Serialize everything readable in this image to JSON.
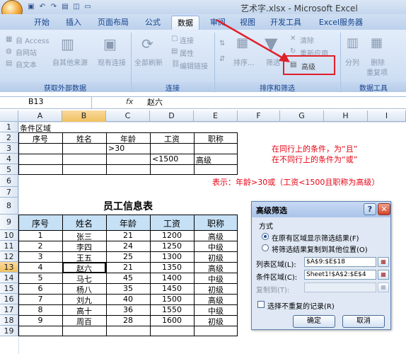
{
  "window": {
    "title": "艺术字.xlsx - Microsoft Excel"
  },
  "tabs": [
    {
      "label": "开始"
    },
    {
      "label": "插入"
    },
    {
      "label": "页面布局"
    },
    {
      "label": "公式"
    },
    {
      "label": "数据"
    },
    {
      "label": "审阅"
    },
    {
      "label": "视图"
    },
    {
      "label": "开发工具"
    },
    {
      "label": "Excel服务器"
    }
  ],
  "ribbon": {
    "ext": {
      "access": "自 Access",
      "web": "自网站",
      "text": "自文本",
      "other": "自其他来源",
      "existing": "现有连接",
      "group": "获取外部数据"
    },
    "conn": {
      "refresh": "全部刷新",
      "connections": "连接",
      "properties": "属性",
      "edit_links": "编辑链接",
      "group": "连接"
    },
    "sort": {
      "sort": "排序...",
      "filter": "筛选",
      "clear": "清除",
      "reapply": "重新应用",
      "advanced": "高级",
      "group": "排序和筛选"
    },
    "tools": {
      "split": "分列",
      "remove_dup": "删除",
      "remove_dup2": "重复项",
      "group": "数据工具"
    }
  },
  "formula_bar": {
    "name_box": "B13",
    "fx": "fx",
    "value": "赵六"
  },
  "columns": [
    "A",
    "B",
    "C",
    "D",
    "E",
    "F",
    "G",
    "H",
    "I"
  ],
  "rows": [
    "1",
    "2",
    "3",
    "4",
    "5",
    "6",
    "7",
    "8",
    "9",
    "10",
    "11",
    "12",
    "13",
    "14",
    "15",
    "16",
    "17",
    "18",
    "19"
  ],
  "sheet": {
    "a1": "条件区域",
    "crit_headers": [
      "序号",
      "姓名",
      "年龄",
      "工资",
      "职称"
    ],
    "crit_age": ">30",
    "crit_salary": "<1500",
    "crit_title": "高级",
    "note1": "在同行上的条件，为“且”",
    "note2": "在不同行上的条件为“或”",
    "note3": "表示：年龄>30或（工资<1500且职称为高级）",
    "table_title": "员工信息表",
    "headers": [
      "序号",
      "姓名",
      "年龄",
      "工资",
      "职称"
    ],
    "data": [
      [
        "1",
        "张三",
        "21",
        "1200",
        "高级"
      ],
      [
        "2",
        "李四",
        "24",
        "1250",
        "中级"
      ],
      [
        "3",
        "王五",
        "25",
        "1300",
        "初级"
      ],
      [
        "4",
        "赵六",
        "21",
        "1350",
        "高级"
      ],
      [
        "5",
        "马七",
        "45",
        "1400",
        "中级"
      ],
      [
        "6",
        "杨八",
        "35",
        "1450",
        "初级"
      ],
      [
        "7",
        "刘九",
        "40",
        "1500",
        "高级"
      ],
      [
        "8",
        "高十",
        "36",
        "1550",
        "中级"
      ],
      [
        "9",
        "周百",
        "28",
        "1600",
        "初级"
      ]
    ]
  },
  "dialog": {
    "title": "高级筛选",
    "help": "?",
    "close": "✕",
    "mode_label": "方式",
    "opt1": "在原有区域显示筛选结果(F)",
    "opt2": "将筛选结果复制到其他位置(O)",
    "list_label": "列表区域(L):",
    "list_value": "$A$9:$E$18",
    "crit_label": "条件区域(C):",
    "crit_value": "Sheet1!$A$2:$E$4",
    "copy_label": "复制到(T):",
    "unique_label": "选择不重复的记录(R)",
    "ok": "确定",
    "cancel": "取消"
  },
  "colors": {
    "highlight": "#e0202a",
    "note": "#e60012",
    "header_fill": "#c6e0f5"
  }
}
